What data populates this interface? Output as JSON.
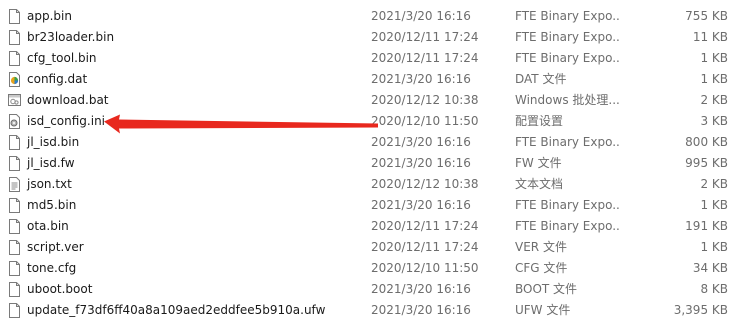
{
  "files": [
    {
      "name": "app.bin",
      "date": "2021/3/20 16:16",
      "type": "FTE Binary Expo...",
      "size": "755 KB",
      "icon": "page-icon"
    },
    {
      "name": "br23loader.bin",
      "date": "2020/12/11 17:24",
      "type": "FTE Binary Expo...",
      "size": "11 KB",
      "icon": "page-icon"
    },
    {
      "name": "cfg_tool.bin",
      "date": "2020/12/11 17:24",
      "type": "FTE Binary Expo...",
      "size": "1 KB",
      "icon": "page-icon"
    },
    {
      "name": "config.dat",
      "date": "2021/3/20 16:16",
      "type": "DAT 文件",
      "size": "1 KB",
      "icon": "media-file-icon"
    },
    {
      "name": "download.bat",
      "date": "2020/12/12 10:38",
      "type": "Windows 批处理...",
      "size": "2 KB",
      "icon": "batch-file-icon"
    },
    {
      "name": "isd_config.ini",
      "date": "2020/12/10 11:50",
      "type": "配置设置",
      "size": "3 KB",
      "icon": "settings-file-icon"
    },
    {
      "name": "jl_isd.bin",
      "date": "2021/3/20 16:16",
      "type": "FTE Binary Expo...",
      "size": "800 KB",
      "icon": "page-icon"
    },
    {
      "name": "jl_isd.fw",
      "date": "2021/3/20 16:16",
      "type": "FW 文件",
      "size": "995 KB",
      "icon": "page-icon"
    },
    {
      "name": "json.txt",
      "date": "2020/12/12 10:38",
      "type": "文本文档",
      "size": "2 KB",
      "icon": "text-file-icon"
    },
    {
      "name": "md5.bin",
      "date": "2021/3/20 16:16",
      "type": "FTE Binary Expo...",
      "size": "1 KB",
      "icon": "page-icon"
    },
    {
      "name": "ota.bin",
      "date": "2020/12/11 17:24",
      "type": "FTE Binary Expo...",
      "size": "191 KB",
      "icon": "page-icon"
    },
    {
      "name": "script.ver",
      "date": "2020/12/11 17:24",
      "type": "VER 文件",
      "size": "1 KB",
      "icon": "page-icon"
    },
    {
      "name": "tone.cfg",
      "date": "2020/12/10 11:50",
      "type": "CFG 文件",
      "size": "34 KB",
      "icon": "page-icon"
    },
    {
      "name": "uboot.boot",
      "date": "2021/3/20 16:16",
      "type": "BOOT 文件",
      "size": "8 KB",
      "icon": "page-icon"
    },
    {
      "name": "update_f73df6ff40a8a109aed2eddfee5b910a.ufw",
      "date": "2021/3/20 16:16",
      "type": "UFW 文件",
      "size": "3,395 KB",
      "icon": "page-icon"
    }
  ],
  "annotation": {
    "color": "#e8281e",
    "points_to": "isd_config.ini"
  }
}
